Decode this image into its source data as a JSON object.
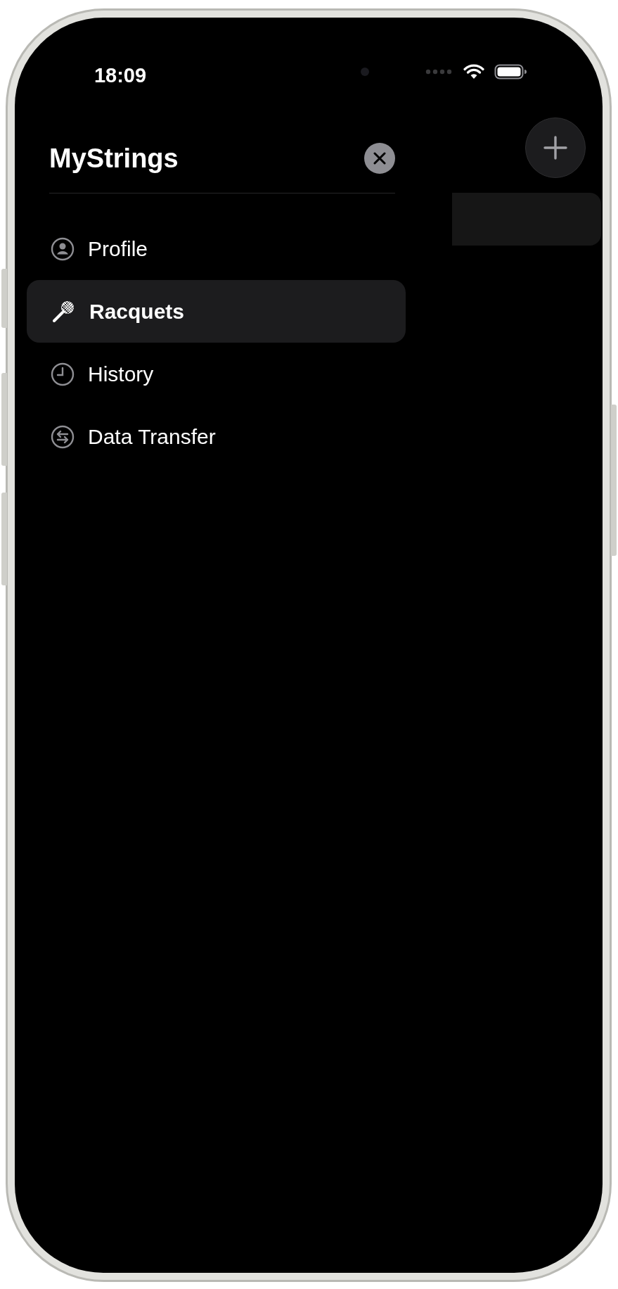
{
  "status_bar": {
    "time": "18:09"
  },
  "drawer": {
    "title": "MyStrings",
    "items": [
      {
        "label": "Profile",
        "selected": false
      },
      {
        "label": "Racquets",
        "selected": true
      },
      {
        "label": "History",
        "selected": false
      },
      {
        "label": "Data Transfer",
        "selected": false
      }
    ]
  }
}
